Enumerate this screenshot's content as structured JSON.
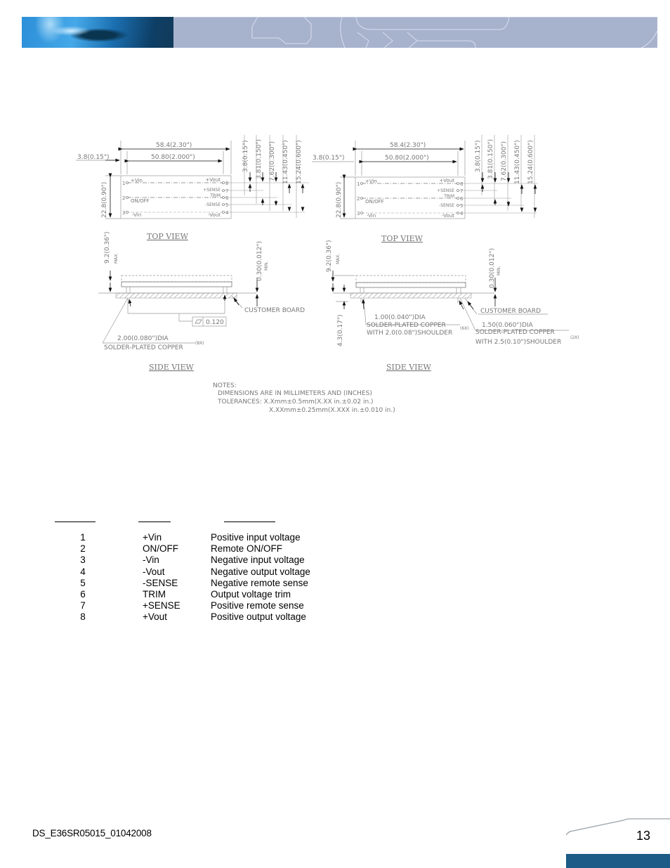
{
  "header": {
    "banner_icon": "company-banner-photo"
  },
  "drawing": {
    "left": {
      "overall_length": "58.4(2.30\")",
      "pin_span": "50.80(2.000\")",
      "edge_offset": "3.8(0.15\")",
      "height": "22.8(0.90\")",
      "right_dims": [
        "3.8(0.15\")",
        "3.81(0.150\")",
        "7.62(0.300\")",
        "11.43(0.450\")",
        "15.24(0.600\")"
      ],
      "pin_labels_left": [
        {
          "num": "1",
          "label": "+Vin"
        },
        {
          "num": "2",
          "label": "ON/OFF"
        },
        {
          "num": "3",
          "label": "-Vin"
        }
      ],
      "pin_labels_right": [
        {
          "num": "8",
          "label": "+Vout"
        },
        {
          "num": "7",
          "label": "+SENSE"
        },
        {
          "num": "6",
          "label": "TRIM"
        },
        {
          "num": "5",
          "label": "-SENSE"
        },
        {
          "num": "4",
          "label": "-Vout"
        }
      ],
      "top_view_title": "TOP VIEW",
      "side_view_title": "SIDE VIEW",
      "max_height": "9.2(0.36\")",
      "max_label": "MAX.",
      "standoff": "0.30(0.012\")",
      "min_label": "MIN.",
      "customer_board": "CUSTOMER BOARD",
      "flatness": "0.120",
      "pin_dia": "2.00(0.080\")DIA",
      "pin_material": "SOLDER-PLATED COPPER",
      "pin_count": "(8X)"
    },
    "right": {
      "overall_length": "58.4(2.30\")",
      "pin_span": "50.80(2.000\")",
      "edge_offset": "3.8(0.15\")",
      "height": "22.8(0.90\")",
      "right_dims": [
        "3.8(0.15\")",
        "3.81(0.150\")",
        "7.62(0.300\")",
        "11.43(0.450\")",
        "15.24(0.600\")"
      ],
      "top_view_title": "TOP VIEW",
      "side_view_title": "SIDE VIEW",
      "max_height": "9.2(0.36\")",
      "max_label": "MAX.",
      "standoff": "0.30(0.012\")",
      "min_label": "MIN.",
      "pin_length": "4.3(0.17\")",
      "customer_board": "CUSTOMER BOARD",
      "small_pin_dia": "1.00(0.040\")DIA",
      "small_pin_material": "SOLDER-PLATED COPPER",
      "small_pin_shoulder": "WITH 2.0(0.08\")SHOULDER",
      "small_pin_count": "(6X)",
      "large_pin_dia": "1.50(0.060\")DIA",
      "large_pin_material": "SOLDER-PLATED COPPER",
      "large_pin_shoulder": "WITH 2.5(0.10\")SHOULDER",
      "large_pin_count": "(2X)"
    },
    "notes": {
      "title": "NOTES:",
      "line1": "DIMENSIONS ARE IN MILLIMETERS AND (INCHES)",
      "line2": "TOLERANCES: X.Xmm±0.5mm(X.XX in.±0.02 in.)",
      "line3": "X.XXmm±0.25mm(X.XXX in.±0.010 in.)"
    }
  },
  "pin_table": {
    "rows": [
      {
        "pin": "1",
        "name": "+Vin",
        "function": "Positive input voltage"
      },
      {
        "pin": "2",
        "name": "ON/OFF",
        "function": "Remote ON/OFF"
      },
      {
        "pin": "3",
        "name": "-Vin",
        "function": "Negative input voltage"
      },
      {
        "pin": "4",
        "name": "-Vout",
        "function": "Negative output voltage"
      },
      {
        "pin": "5",
        "name": "-SENSE",
        "function": "Negative remote sense"
      },
      {
        "pin": "6",
        "name": "TRIM",
        "function": "Output voltage trim"
      },
      {
        "pin": "7",
        "name": "+SENSE",
        "function": "Positive remote sense"
      },
      {
        "pin": "8",
        "name": "+Vout",
        "function": "Positive output voltage"
      }
    ]
  },
  "footer": {
    "doc_id": "DS_E36SR05015_01042008",
    "page_number": "13",
    "accent_color": "#1c5c86"
  }
}
